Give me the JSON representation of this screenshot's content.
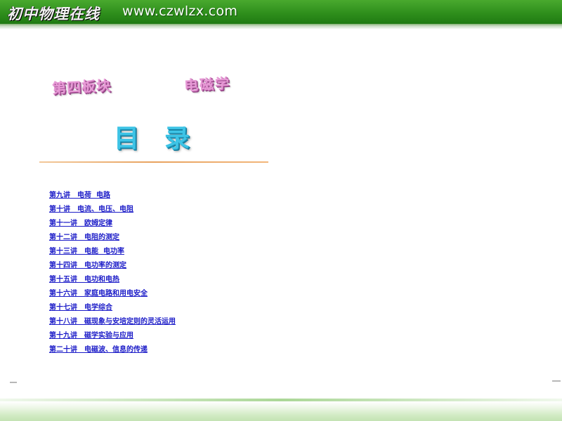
{
  "header": {
    "logo_text": "初中物理在线",
    "site_url": "www.czwlzx.com"
  },
  "section": {
    "title": "第四板块",
    "subtitle": "电磁学"
  },
  "toc": {
    "heading": "目录",
    "items": [
      "第九讲　电荷  电路",
      "第十讲　电流、电压、电阻",
      "第十一讲　欧姆定律",
      "第十二讲　电阻的测定",
      "第十三讲　电能  电功率",
      "第十四讲　电功率的测定",
      "第十五讲　电功和电热",
      "第十六讲　家庭电路和用电安全",
      "第十七讲　电学综合",
      "第十八讲　磁现象与安培定则的灵活运用",
      "第十九讲　磁学实验与应用",
      "第二十讲　电磁波、信息的传递"
    ]
  },
  "colors": {
    "banner_green": "#2f8f1c",
    "section_pink": "#e79ad6",
    "heading_cyan": "#3ec4e6",
    "link_blue": "#1c1cc8",
    "divider_orange": "#e8a25e"
  }
}
